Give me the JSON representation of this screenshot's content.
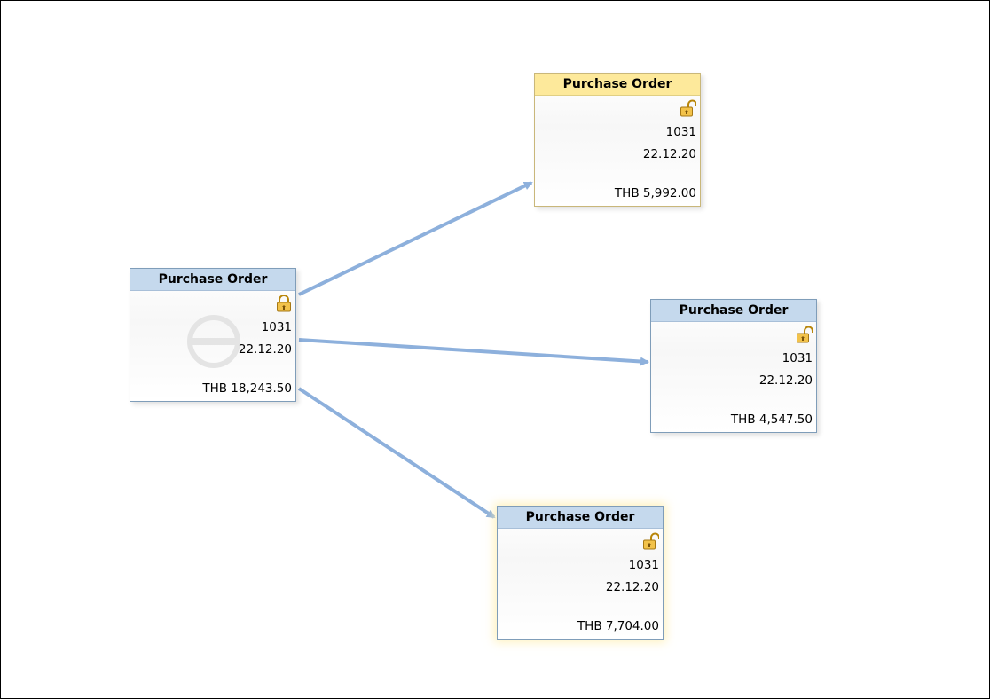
{
  "diagram": {
    "nodes": [
      {
        "id": "root",
        "title": "Purchase Order",
        "number": "1031",
        "date": "22.12.20",
        "amount": "THB 18,243.50",
        "lock": "locked-padlock-icon",
        "watermark": "blocked-circle-icon"
      },
      {
        "id": "child1",
        "title": "Purchase Order",
        "number": "1031",
        "date": "22.12.20",
        "amount": "THB 5,992.00",
        "lock": "unlocked-padlock-icon",
        "highlight": "#fde99b"
      },
      {
        "id": "child2",
        "title": "Purchase Order",
        "number": "1031",
        "date": "22.12.20",
        "amount": "THB 4,547.50",
        "lock": "unlocked-padlock-icon"
      },
      {
        "id": "child3",
        "title": "Purchase Order",
        "number": "1031",
        "date": "22.12.20",
        "amount": "THB 7,704.00",
        "lock": "unlocked-padlock-icon"
      }
    ],
    "edges": [
      {
        "from": "root",
        "to": "child1"
      },
      {
        "from": "root",
        "to": "child2"
      },
      {
        "from": "root",
        "to": "child3"
      }
    ],
    "colors": {
      "arrow": "#8db0dc",
      "header_blue": "#c5d9ed",
      "header_yellow": "#fde99b",
      "border": "#7f9db9"
    }
  }
}
